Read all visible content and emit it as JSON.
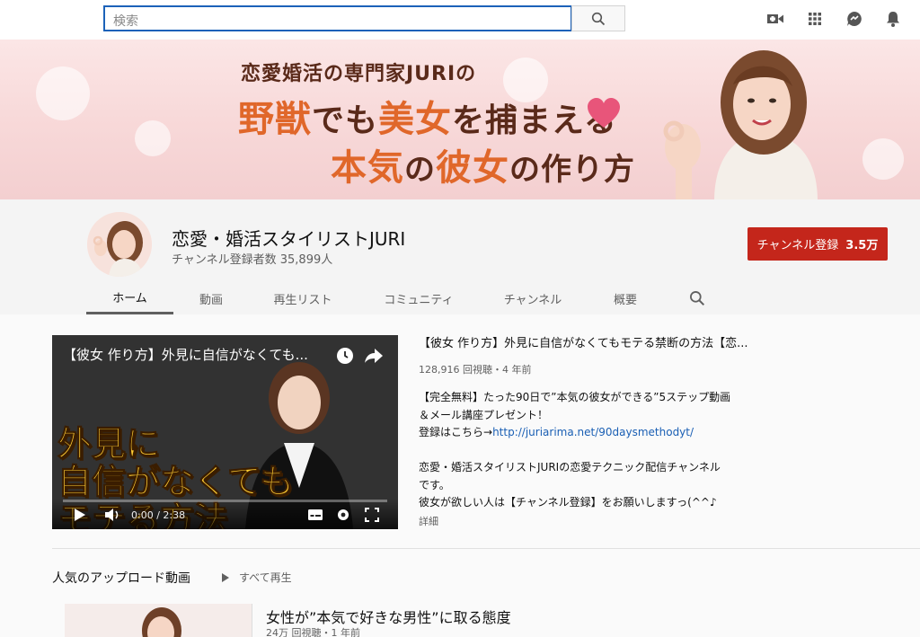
{
  "search": {
    "placeholder": "検索"
  },
  "topbar": {
    "icons": [
      "search-icon",
      "video-camera-icon",
      "apps-grid-icon",
      "messages-icon",
      "bell-icon"
    ]
  },
  "banner": {
    "line1": "恋愛婚活の専門家JURIの",
    "line2_parts": [
      "野獣",
      "でも",
      "美女",
      "を捕まえる"
    ],
    "line3_parts": [
      "本気",
      "の",
      "彼女",
      "の作り方"
    ]
  },
  "channel": {
    "name": "恋愛・婚活スタイリストJURI",
    "subscribers": "チャンネル登録者数 35,899人",
    "subscribe_label": "チャンネル登録",
    "subscribe_count": "3.5万"
  },
  "tabs": [
    {
      "label": "ホーム",
      "active": true
    },
    {
      "label": "動画"
    },
    {
      "label": "再生リスト"
    },
    {
      "label": "コミュニティ"
    },
    {
      "label": "チャンネル"
    },
    {
      "label": "概要"
    }
  ],
  "featured": {
    "player_title": "【彼女 作り方】外見に自信がなくても...",
    "overlay_lines": [
      "外見に",
      "自信がなくても",
      "モテる方法"
    ],
    "time": "0:00 / 2:38",
    "title": "【彼女 作り方】外見に自信がなくてもモテる禁断の方法【恋...",
    "meta": "128,916 回視聴・4 年前",
    "desc_lines": [
      "【完全無料】たった90日で”本気の彼女ができる”5ステップ動画",
      "＆メール講座プレゼント！",
      "登録はこちら→",
      "",
      "恋愛・婚活スタイリストJURIの恋愛テクニック配信チャンネル",
      "です。",
      "彼女が欲しい人は【チャンネル登録】をお願いしますっ(^^♪"
    ],
    "link": "http://juriarima.net/90daysmethodyt/",
    "more": "詳細"
  },
  "popular": {
    "title": "人気のアップロード動画",
    "play_all": "すべて再生",
    "video_title": "女性が”本気で好きな男性”に取る態度",
    "video_meta": "24万 回視聴・1 年前"
  }
}
